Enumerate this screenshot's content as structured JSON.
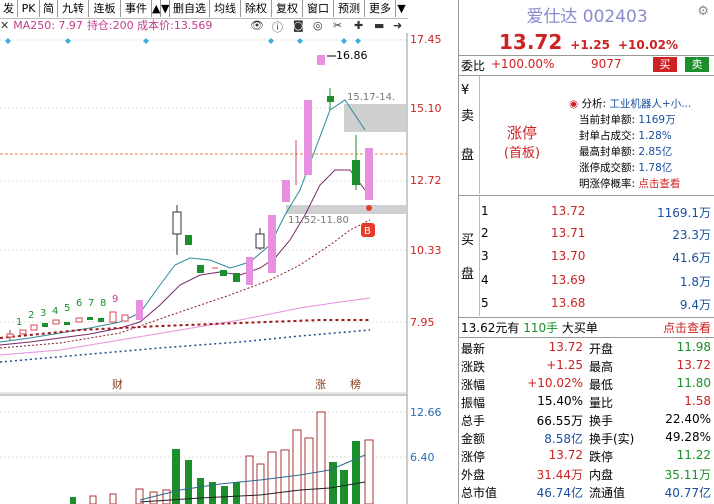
{
  "toolbar": {
    "buttons": [
      "发",
      "PK",
      "简",
      "九转",
      "连板",
      "事件",
      "删自选",
      "均线",
      "除权",
      "复权",
      "窗口",
      "预测",
      "更多"
    ],
    "scroll_up": "▲",
    "scroll_down": "▼"
  },
  "infobar": {
    "ma": "MA250: 7.97",
    "hold": "持仓:200 成本价:13.569"
  },
  "price_axis": [
    "17.45",
    "15.10",
    "12.72",
    "10.33",
    "7.95"
  ],
  "volume_axis": [
    "12.66",
    "6.40"
  ],
  "annotations": {
    "high": "16.86",
    "cost_band_upper": "15.17-14.",
    "cost_band_lower": "11.52-11.80",
    "buy_marker": "B",
    "sequence": [
      "1",
      "2",
      "3",
      "4",
      "5",
      "6",
      "7",
      "8",
      "9"
    ],
    "event_cai": "财",
    "event_zhang": "涨",
    "event_bang": "榜"
  },
  "stock": {
    "title": "爱仕达 002403",
    "price": "13.72",
    "change": "+1.25",
    "pct": "+10.02%"
  },
  "weibi": {
    "label": "委比",
    "value": "+100.00%",
    "count": "9077",
    "sell_btn": "买",
    "buy_btn": "卖"
  },
  "sell_side": {
    "label": [
      "卖",
      "盘"
    ],
    "status": "涨停",
    "status_sub": "(首板)"
  },
  "analysis": {
    "rows": [
      {
        "k": "分析:",
        "v": "工业机器人+小..."
      },
      {
        "k": "当前封单额:",
        "v": "1169万"
      },
      {
        "k": "封单占成交:",
        "v": "1.28%"
      },
      {
        "k": "最高封单额:",
        "v": "2.85亿"
      },
      {
        "k": "涨停成交额:",
        "v": "1.78亿"
      },
      {
        "k": "明涨停概率:",
        "v": "点击查看"
      }
    ]
  },
  "buy_side": {
    "label": [
      "买",
      "盘"
    ],
    "rows": [
      {
        "n": "1",
        "p": "13.72",
        "q": "1169.1万"
      },
      {
        "n": "2",
        "p": "13.71",
        "q": "23.3万"
      },
      {
        "n": "3",
        "p": "13.70",
        "q": "41.6万"
      },
      {
        "n": "4",
        "p": "13.69",
        "q": "1.8万"
      },
      {
        "n": "5",
        "p": "13.68",
        "q": "9.4万"
      }
    ]
  },
  "trade_line": {
    "price": "13.62元有",
    "lots": "110手",
    "type": "大买单",
    "link": "点击查看"
  },
  "stats": [
    {
      "k1": "最新",
      "v1": "13.72",
      "k2": "开盘",
      "v2": "11.98"
    },
    {
      "k1": "涨跌",
      "v1": "+1.25",
      "k2": "最高",
      "v2": "13.72"
    },
    {
      "k1": "涨幅",
      "v1": "+10.02%",
      "k2": "最低",
      "v2": "11.80"
    },
    {
      "k1": "振幅",
      "v1": "15.40%",
      "k2": "量比",
      "v2": "1.58"
    },
    {
      "k1": "总手",
      "v1": "66.55万",
      "k2": "换手",
      "v2": "22.40%"
    },
    {
      "k1": "金额",
      "v1": "8.58亿",
      "k2": "换手(实)",
      "v2": "49.28%"
    },
    {
      "k1": "涨停",
      "v1": "13.72",
      "k2": "跌停",
      "v2": "11.22"
    },
    {
      "k1": "外盘",
      "v1": "31.44万",
      "k2": "内盘",
      "v2": "35.11万"
    },
    {
      "k1": "总市值",
      "v1": "46.74亿",
      "k2": "流通值",
      "v2": "40.77亿"
    }
  ]
}
